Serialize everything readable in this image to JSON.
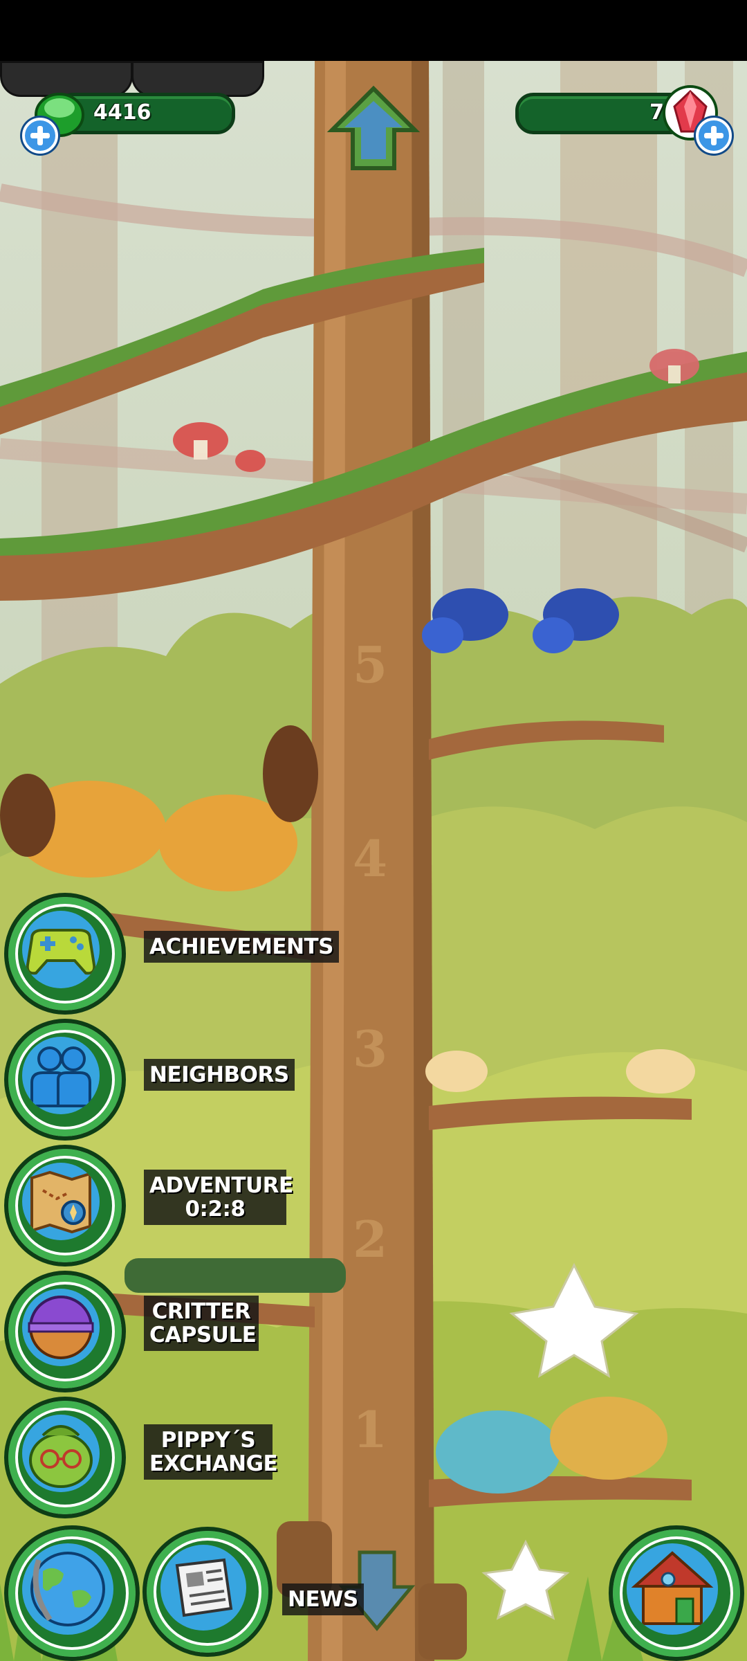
{
  "resources": {
    "gems": "4416",
    "rubies": "7"
  },
  "tree_levels": [
    "1",
    "2",
    "3",
    "4",
    "5"
  ],
  "menu": {
    "achievements": "ACHIEVEMENTS",
    "neighbors": "NEIGHBORS",
    "adventure": "ADVENTURE",
    "adventure_timer": "0:2:8",
    "critter_capsule_line1": "CRITTER",
    "critter_capsule_line2": "CAPSULE",
    "pippys_line1": "PIPPY´S",
    "pippys_line2": "EXCHANGE",
    "news": "NEWS"
  },
  "colors": {
    "sky": "#c7d7c0",
    "trunk": "#b07a45",
    "foliage": "#9db83e",
    "button_ring": "#3fb04e"
  },
  "icons": [
    "gem-icon",
    "ruby-icon",
    "up-arrow-icon",
    "down-arrow-icon",
    "gamepad-icon",
    "neighbors-icon",
    "map-icon",
    "capsule-icon",
    "pippy-icon",
    "globe-icon",
    "newspaper-icon",
    "house-icon"
  ]
}
